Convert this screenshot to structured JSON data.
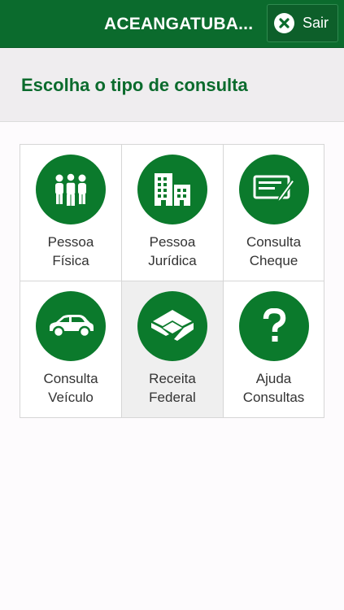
{
  "header": {
    "title": "ACEANGATUBA...",
    "exit_label": "Sair"
  },
  "subheader": {
    "title": "Escolha o tipo de consulta"
  },
  "tiles": [
    {
      "line1": "Pessoa",
      "line2": "Física",
      "icon": "people-icon"
    },
    {
      "line1": "Pessoa",
      "line2": "Jurídica",
      "icon": "buildings-icon"
    },
    {
      "line1": "Consulta",
      "line2": "Cheque",
      "icon": "cheque-icon"
    },
    {
      "line1": "Consulta",
      "line2": "Veículo",
      "icon": "car-icon"
    },
    {
      "line1": "Receita",
      "line2": "Federal",
      "icon": "receita-federal-icon"
    },
    {
      "line1": "Ajuda",
      "line2": "Consultas",
      "icon": "question-icon"
    }
  ],
  "colors": {
    "brand_green": "#0b6b2d",
    "icon_green": "#0b7a2c",
    "background": "#fdfbfd",
    "subheader_bg": "#efedef"
  }
}
